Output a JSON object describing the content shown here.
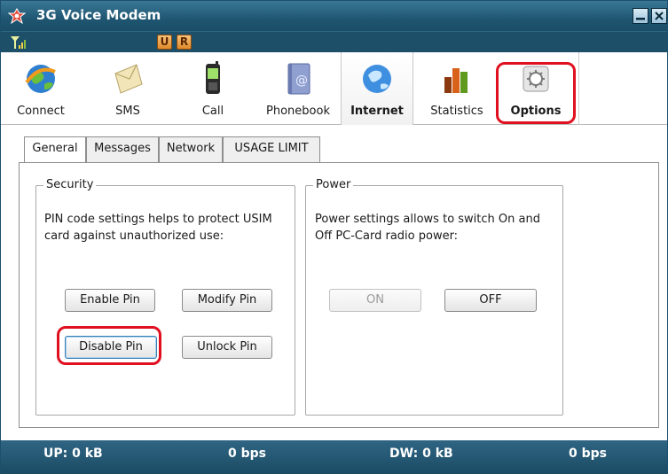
{
  "window": {
    "title": "3G Voice Modem"
  },
  "status_strip": {
    "badge_u": "U",
    "badge_r": "R"
  },
  "toolbar": {
    "items": [
      {
        "label": "Connect"
      },
      {
        "label": "SMS"
      },
      {
        "label": "Call"
      },
      {
        "label": "Phonebook"
      },
      {
        "label": "Internet"
      },
      {
        "label": "Statistics"
      },
      {
        "label": "Options"
      }
    ]
  },
  "tabs": [
    {
      "label": "General"
    },
    {
      "label": "Messages"
    },
    {
      "label": "Network"
    },
    {
      "label": "USAGE LIMIT"
    }
  ],
  "security": {
    "title": "Security",
    "desc_line1": "PIN code settings helps to protect USIM",
    "desc_line2": "card against unauthorized use:",
    "enable_pin": "Enable Pin",
    "modify_pin": "Modify Pin",
    "disable_pin": "Disable Pin",
    "unlock_pin": "Unlock Pin"
  },
  "power": {
    "title": "Power",
    "desc_line1": "Power settings allows to switch On and",
    "desc_line2": "Off PC-Card radio power:",
    "on": "ON",
    "off": "OFF"
  },
  "bottom_bar": {
    "up": "UP: 0 kB",
    "up_rate": "0 bps",
    "dw": "DW: 0 kB",
    "dw_rate": "0 bps"
  },
  "colors": {
    "title_bar": "#1f5672",
    "highlight": "#e01020",
    "bottom_bar": "#1b4b64"
  }
}
